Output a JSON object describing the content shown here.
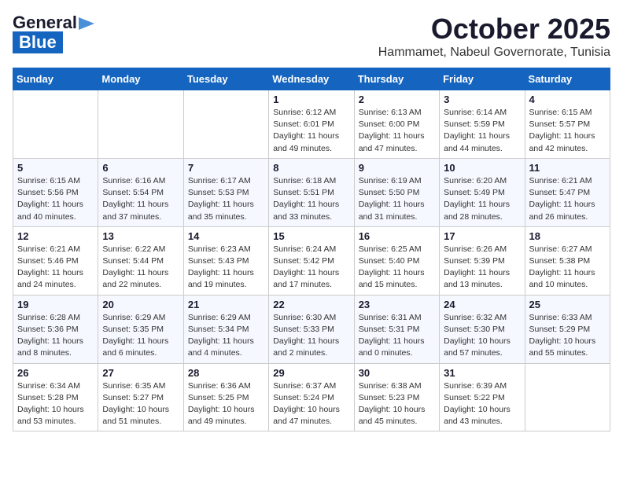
{
  "header": {
    "logo_general": "General",
    "logo_blue": "Blue",
    "month": "October 2025",
    "location": "Hammamet, Nabeul Governorate, Tunisia"
  },
  "weekdays": [
    "Sunday",
    "Monday",
    "Tuesday",
    "Wednesday",
    "Thursday",
    "Friday",
    "Saturday"
  ],
  "weeks": [
    [
      {
        "day": "",
        "sunrise": "",
        "sunset": "",
        "daylight": ""
      },
      {
        "day": "",
        "sunrise": "",
        "sunset": "",
        "daylight": ""
      },
      {
        "day": "",
        "sunrise": "",
        "sunset": "",
        "daylight": ""
      },
      {
        "day": "1",
        "sunrise": "Sunrise: 6:12 AM",
        "sunset": "Sunset: 6:01 PM",
        "daylight": "Daylight: 11 hours and 49 minutes."
      },
      {
        "day": "2",
        "sunrise": "Sunrise: 6:13 AM",
        "sunset": "Sunset: 6:00 PM",
        "daylight": "Daylight: 11 hours and 47 minutes."
      },
      {
        "day": "3",
        "sunrise": "Sunrise: 6:14 AM",
        "sunset": "Sunset: 5:59 PM",
        "daylight": "Daylight: 11 hours and 44 minutes."
      },
      {
        "day": "4",
        "sunrise": "Sunrise: 6:15 AM",
        "sunset": "Sunset: 5:57 PM",
        "daylight": "Daylight: 11 hours and 42 minutes."
      }
    ],
    [
      {
        "day": "5",
        "sunrise": "Sunrise: 6:15 AM",
        "sunset": "Sunset: 5:56 PM",
        "daylight": "Daylight: 11 hours and 40 minutes."
      },
      {
        "day": "6",
        "sunrise": "Sunrise: 6:16 AM",
        "sunset": "Sunset: 5:54 PM",
        "daylight": "Daylight: 11 hours and 37 minutes."
      },
      {
        "day": "7",
        "sunrise": "Sunrise: 6:17 AM",
        "sunset": "Sunset: 5:53 PM",
        "daylight": "Daylight: 11 hours and 35 minutes."
      },
      {
        "day": "8",
        "sunrise": "Sunrise: 6:18 AM",
        "sunset": "Sunset: 5:51 PM",
        "daylight": "Daylight: 11 hours and 33 minutes."
      },
      {
        "day": "9",
        "sunrise": "Sunrise: 6:19 AM",
        "sunset": "Sunset: 5:50 PM",
        "daylight": "Daylight: 11 hours and 31 minutes."
      },
      {
        "day": "10",
        "sunrise": "Sunrise: 6:20 AM",
        "sunset": "Sunset: 5:49 PM",
        "daylight": "Daylight: 11 hours and 28 minutes."
      },
      {
        "day": "11",
        "sunrise": "Sunrise: 6:21 AM",
        "sunset": "Sunset: 5:47 PM",
        "daylight": "Daylight: 11 hours and 26 minutes."
      }
    ],
    [
      {
        "day": "12",
        "sunrise": "Sunrise: 6:21 AM",
        "sunset": "Sunset: 5:46 PM",
        "daylight": "Daylight: 11 hours and 24 minutes."
      },
      {
        "day": "13",
        "sunrise": "Sunrise: 6:22 AM",
        "sunset": "Sunset: 5:44 PM",
        "daylight": "Daylight: 11 hours and 22 minutes."
      },
      {
        "day": "14",
        "sunrise": "Sunrise: 6:23 AM",
        "sunset": "Sunset: 5:43 PM",
        "daylight": "Daylight: 11 hours and 19 minutes."
      },
      {
        "day": "15",
        "sunrise": "Sunrise: 6:24 AM",
        "sunset": "Sunset: 5:42 PM",
        "daylight": "Daylight: 11 hours and 17 minutes."
      },
      {
        "day": "16",
        "sunrise": "Sunrise: 6:25 AM",
        "sunset": "Sunset: 5:40 PM",
        "daylight": "Daylight: 11 hours and 15 minutes."
      },
      {
        "day": "17",
        "sunrise": "Sunrise: 6:26 AM",
        "sunset": "Sunset: 5:39 PM",
        "daylight": "Daylight: 11 hours and 13 minutes."
      },
      {
        "day": "18",
        "sunrise": "Sunrise: 6:27 AM",
        "sunset": "Sunset: 5:38 PM",
        "daylight": "Daylight: 11 hours and 10 minutes."
      }
    ],
    [
      {
        "day": "19",
        "sunrise": "Sunrise: 6:28 AM",
        "sunset": "Sunset: 5:36 PM",
        "daylight": "Daylight: 11 hours and 8 minutes."
      },
      {
        "day": "20",
        "sunrise": "Sunrise: 6:29 AM",
        "sunset": "Sunset: 5:35 PM",
        "daylight": "Daylight: 11 hours and 6 minutes."
      },
      {
        "day": "21",
        "sunrise": "Sunrise: 6:29 AM",
        "sunset": "Sunset: 5:34 PM",
        "daylight": "Daylight: 11 hours and 4 minutes."
      },
      {
        "day": "22",
        "sunrise": "Sunrise: 6:30 AM",
        "sunset": "Sunset: 5:33 PM",
        "daylight": "Daylight: 11 hours and 2 minutes."
      },
      {
        "day": "23",
        "sunrise": "Sunrise: 6:31 AM",
        "sunset": "Sunset: 5:31 PM",
        "daylight": "Daylight: 11 hours and 0 minutes."
      },
      {
        "day": "24",
        "sunrise": "Sunrise: 6:32 AM",
        "sunset": "Sunset: 5:30 PM",
        "daylight": "Daylight: 10 hours and 57 minutes."
      },
      {
        "day": "25",
        "sunrise": "Sunrise: 6:33 AM",
        "sunset": "Sunset: 5:29 PM",
        "daylight": "Daylight: 10 hours and 55 minutes."
      }
    ],
    [
      {
        "day": "26",
        "sunrise": "Sunrise: 6:34 AM",
        "sunset": "Sunset: 5:28 PM",
        "daylight": "Daylight: 10 hours and 53 minutes."
      },
      {
        "day": "27",
        "sunrise": "Sunrise: 6:35 AM",
        "sunset": "Sunset: 5:27 PM",
        "daylight": "Daylight: 10 hours and 51 minutes."
      },
      {
        "day": "28",
        "sunrise": "Sunrise: 6:36 AM",
        "sunset": "Sunset: 5:25 PM",
        "daylight": "Daylight: 10 hours and 49 minutes."
      },
      {
        "day": "29",
        "sunrise": "Sunrise: 6:37 AM",
        "sunset": "Sunset: 5:24 PM",
        "daylight": "Daylight: 10 hours and 47 minutes."
      },
      {
        "day": "30",
        "sunrise": "Sunrise: 6:38 AM",
        "sunset": "Sunset: 5:23 PM",
        "daylight": "Daylight: 10 hours and 45 minutes."
      },
      {
        "day": "31",
        "sunrise": "Sunrise: 6:39 AM",
        "sunset": "Sunset: 5:22 PM",
        "daylight": "Daylight: 10 hours and 43 minutes."
      },
      {
        "day": "",
        "sunrise": "",
        "sunset": "",
        "daylight": ""
      }
    ]
  ]
}
